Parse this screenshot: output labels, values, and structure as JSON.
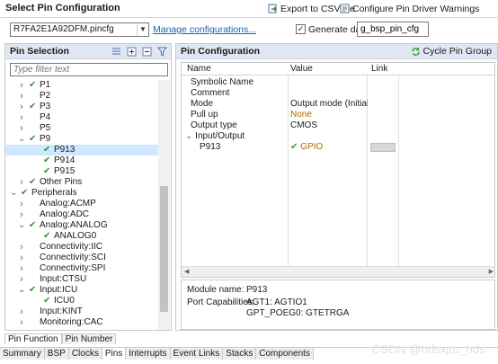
{
  "header": {
    "title": "Select Pin Configuration",
    "export_label": "Export to CSV file",
    "configure_label": "Configure Pin Driver Warnings"
  },
  "config": {
    "selected_file": "R7FA2E1A92DFM.pincfg",
    "manage_link": "Manage configurations...",
    "generate_checked": true,
    "generate_label": "Generate data:",
    "generate_value": "g_bsp_pin_cfg"
  },
  "pin_selection": {
    "title": "Pin Selection",
    "filter_placeholder": "Type filter text",
    "items": [
      {
        "label": "P1",
        "level": 1,
        "expander": "collapsed",
        "check": true
      },
      {
        "label": "P2",
        "level": 1,
        "expander": "collapsed",
        "check": false
      },
      {
        "label": "P3",
        "level": 1,
        "expander": "collapsed",
        "check": true
      },
      {
        "label": "P4",
        "level": 1,
        "expander": "collapsed",
        "check": false
      },
      {
        "label": "P5",
        "level": 1,
        "expander": "collapsed",
        "check": false
      },
      {
        "label": "P9",
        "level": 1,
        "expander": "expanded",
        "check": true
      },
      {
        "label": "P913",
        "level": 2,
        "expander": "none",
        "check": true,
        "selected": true
      },
      {
        "label": "P914",
        "level": 2,
        "expander": "none",
        "check": true
      },
      {
        "label": "P915",
        "level": 2,
        "expander": "none",
        "check": true
      },
      {
        "label": "Other Pins",
        "level": 1,
        "expander": "collapsed",
        "check": true
      },
      {
        "label": "Peripherals",
        "level": 0,
        "expander": "expanded",
        "check": true
      },
      {
        "label": "Analog:ACMP",
        "level": 1,
        "expander": "collapsed",
        "check": false
      },
      {
        "label": "Analog:ADC",
        "level": 1,
        "expander": "collapsed",
        "check": false
      },
      {
        "label": "Analog:ANALOG",
        "level": 1,
        "expander": "expanded",
        "check": true
      },
      {
        "label": "ANALOG0",
        "level": 2,
        "expander": "none",
        "check": true
      },
      {
        "label": "Connectivity:IIC",
        "level": 1,
        "expander": "collapsed",
        "check": false
      },
      {
        "label": "Connectivity:SCI",
        "level": 1,
        "expander": "collapsed",
        "check": false
      },
      {
        "label": "Connectivity:SPI",
        "level": 1,
        "expander": "collapsed",
        "check": false
      },
      {
        "label": "Input:CTSU",
        "level": 1,
        "expander": "collapsed",
        "check": false
      },
      {
        "label": "Input:ICU",
        "level": 1,
        "expander": "expanded",
        "check": true
      },
      {
        "label": "ICU0",
        "level": 2,
        "expander": "none",
        "check": true
      },
      {
        "label": "Input:KINT",
        "level": 1,
        "expander": "collapsed",
        "check": false
      },
      {
        "label": "Monitoring:CAC",
        "level": 1,
        "expander": "collapsed",
        "check": false
      }
    ]
  },
  "pin_config": {
    "title": "Pin Configuration",
    "cycle_label": "Cycle Pin Group",
    "columns": [
      "Name",
      "Value",
      "Link"
    ],
    "rows": [
      {
        "name": "Symbolic Name",
        "value": "",
        "indent": 1
      },
      {
        "name": "Comment",
        "value": "",
        "indent": 1
      },
      {
        "name": "Mode",
        "value": "Output mode (Initial L...",
        "indent": 1
      },
      {
        "name": "Pull up",
        "value": "None",
        "indent": 1
      },
      {
        "name": "Output type",
        "value": "CMOS",
        "indent": 1
      },
      {
        "name": "Input/Output",
        "value": "",
        "indent": 0,
        "expander": "expanded"
      },
      {
        "name": "P913",
        "value": "GPIO",
        "indent": 2,
        "gpio": true,
        "link_button": "..."
      }
    ],
    "info": {
      "module_label": "Module name:",
      "module_value": "P913",
      "port_label": "Port Capabilities:",
      "port_values": [
        "AGT1: AGTIO1",
        "GPT_POEG0: GTETRGA"
      ]
    }
  },
  "sub_tabs": [
    "Pin Function",
    "Pin Number"
  ],
  "active_sub_tab": "Pin Function",
  "bottom_tabs": [
    "Summary",
    "BSP",
    "Clocks",
    "Pins",
    "Interrupts",
    "Event Links",
    "Stacks",
    "Components"
  ],
  "active_bottom_tab": "Pins",
  "watermark": "CSDN @hdsxjtu_hds",
  "colors": {
    "check_green": "#2f9a33",
    "gpio_text": "#a47000",
    "selection": "#cde8ff",
    "panel_header": "#dfe8f2"
  }
}
